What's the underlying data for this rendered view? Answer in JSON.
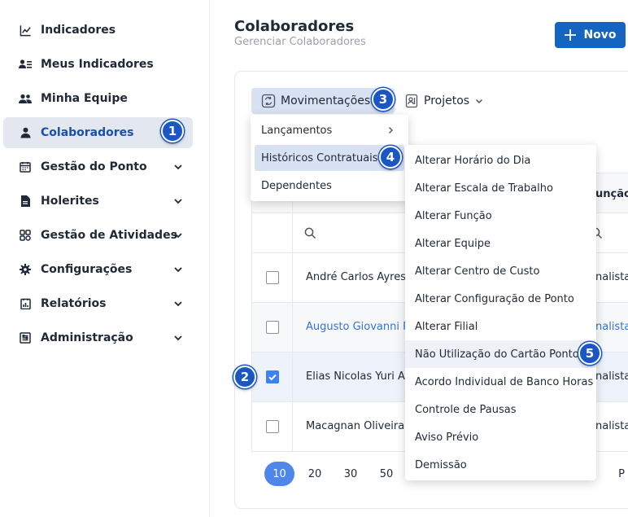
{
  "sidebar": {
    "items": [
      {
        "label": "Indicadores",
        "icon": "chart-line-icon"
      },
      {
        "label": "Meus Indicadores",
        "icon": "user-list-icon"
      },
      {
        "label": "Minha Equipe",
        "icon": "team-icon"
      },
      {
        "label": "Colaboradores",
        "icon": "user-icon"
      },
      {
        "label": "Gestão do Ponto",
        "icon": "calendar-icon"
      },
      {
        "label": "Holerites",
        "icon": "document-icon"
      },
      {
        "label": "Gestão de Atividades",
        "icon": "grid-icon"
      },
      {
        "label": "Configurações",
        "icon": "gear-icon"
      },
      {
        "label": "Relatórios",
        "icon": "report-icon"
      },
      {
        "label": "Administração",
        "icon": "admin-icon"
      }
    ]
  },
  "header": {
    "title": "Colaboradores",
    "subtitle": "Gerenciar Colaboradores",
    "new_button": "Novo"
  },
  "toolbar": {
    "movimentacoes": "Movimentações",
    "projetos": "Projetos"
  },
  "menu_movimentacoes": {
    "items": [
      "Lançamentos",
      "Históricos Contratuais",
      "Dependentes"
    ]
  },
  "menu_historicos": {
    "items": [
      "Alterar Horário do Dia",
      "Alterar Escala de Trabalho",
      "Alterar Função",
      "Alterar Equipe",
      "Alterar Centro de Custo",
      "Alterar Configuração de Ponto",
      "Alterar Filial",
      "Não Utilização do Cartão Ponto",
      "Acordo Individual de Banco Horas",
      "Controle de Pausas",
      "Aviso Prévio",
      "Demissão"
    ]
  },
  "table": {
    "header_partial": "unção",
    "rows": [
      {
        "name": "André Carlos Ayres",
        "role": "nalista"
      },
      {
        "name": "Augusto Giovanni Po",
        "role": "nalista"
      },
      {
        "name": "Elias Nicolas Yuri Alv",
        "role": "nalista"
      },
      {
        "name": "Macagnan Oliveira",
        "role": "nalista"
      }
    ]
  },
  "pagination": {
    "sizes": [
      "10",
      "20",
      "30",
      "50"
    ],
    "partial": "P"
  },
  "badges": [
    "1",
    "2",
    "3",
    "4",
    "5"
  ],
  "colors": {
    "primary": "#1565c0",
    "badge": "#1b57c4",
    "active_nav": "#e3e8f0",
    "link": "#3572d6",
    "checkbox": "#3b82f6"
  }
}
